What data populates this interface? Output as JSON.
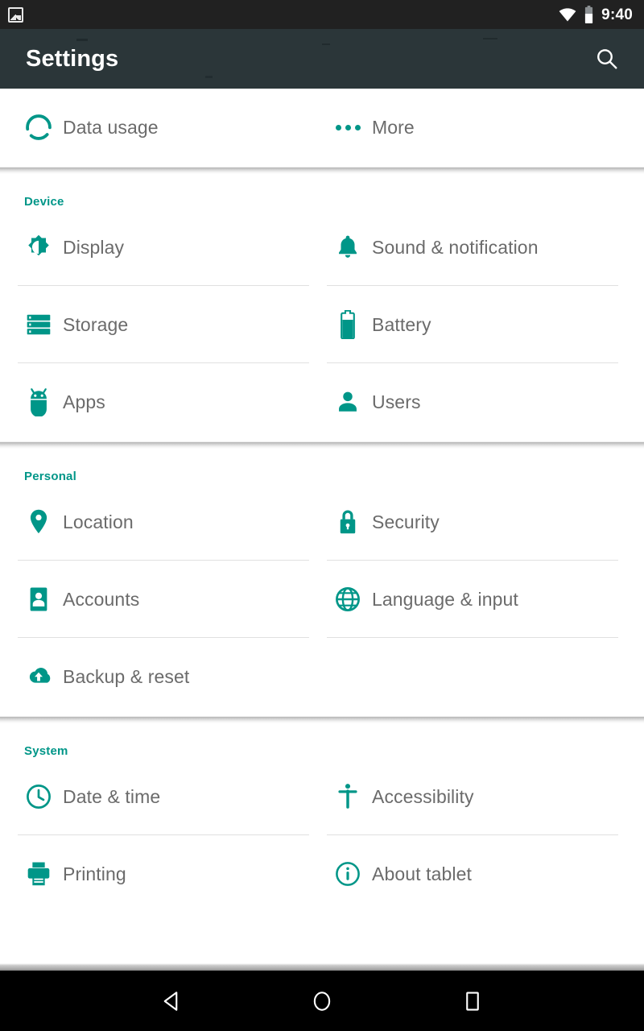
{
  "statusbar": {
    "notification_icon": "photo-icon",
    "wifi_icon": "wifi-icon",
    "battery_icon": "battery-icon",
    "clock": "9:40"
  },
  "actionbar": {
    "title": "Settings",
    "search_icon": "search-icon"
  },
  "sections": [
    {
      "id": "wireless",
      "title": "",
      "rows": [
        {
          "icon": "data-usage-icon",
          "label": "Data usage"
        },
        {
          "icon": "more-dots-icon",
          "label": "More"
        }
      ]
    },
    {
      "id": "device",
      "title": "Device",
      "rows": [
        {
          "icon": "brightness-icon",
          "label": "Display"
        },
        {
          "icon": "bell-icon",
          "label": "Sound & notification"
        },
        {
          "icon": "storage-icon",
          "label": "Storage"
        },
        {
          "icon": "battery-icon",
          "label": "Battery"
        },
        {
          "icon": "android-robot-icon",
          "label": "Apps"
        },
        {
          "icon": "person-icon",
          "label": "Users"
        }
      ]
    },
    {
      "id": "personal",
      "title": "Personal",
      "rows": [
        {
          "icon": "location-pin-icon",
          "label": "Location"
        },
        {
          "icon": "lock-icon",
          "label": "Security"
        },
        {
          "icon": "account-card-icon",
          "label": "Accounts"
        },
        {
          "icon": "globe-icon",
          "label": "Language & input"
        },
        {
          "icon": "cloud-upload-icon",
          "label": "Backup & reset"
        }
      ]
    },
    {
      "id": "system",
      "title": "System",
      "rows": [
        {
          "icon": "clock-icon",
          "label": "Date & time"
        },
        {
          "icon": "accessibility-icon",
          "label": "Accessibility"
        },
        {
          "icon": "printer-icon",
          "label": "Printing"
        },
        {
          "icon": "info-icon",
          "label": "About tablet"
        }
      ]
    }
  ],
  "navbar": {
    "back": "back-icon",
    "home": "home-icon",
    "recents": "recents-icon"
  },
  "colors": {
    "accent": "#009688",
    "actionbar": "#2b3639",
    "statusbar": "#212121",
    "label": "#6b6b6b",
    "divider": "#e0e0e0"
  }
}
